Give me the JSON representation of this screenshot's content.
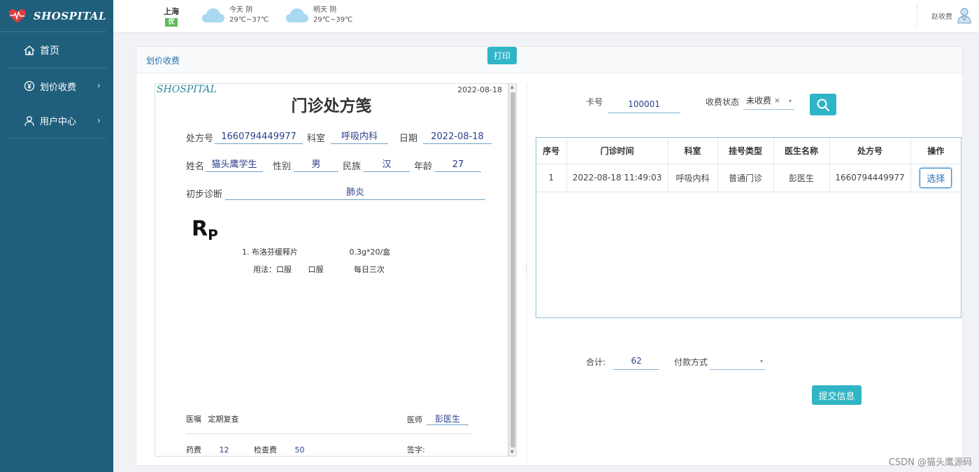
{
  "brand": {
    "name": "SHOSPITAL"
  },
  "sidebar": {
    "items": [
      {
        "label": "首页",
        "icon": "home-icon"
      },
      {
        "label": "划价收费",
        "icon": "yen-circle-icon"
      },
      {
        "label": "用户中心",
        "icon": "user-icon"
      }
    ]
  },
  "header": {
    "city": "上海",
    "aqi": "优",
    "today": {
      "label": "今天  阴",
      "temp": "29℃~37℃"
    },
    "tomorrow": {
      "label": "明天  阴",
      "temp": "29℃~39℃"
    },
    "user": "赵收费"
  },
  "panel": {
    "title": "划价收费",
    "print_label": "打印"
  },
  "prescription": {
    "brand": "SHOSPITAL",
    "date_top": "2022-08-18",
    "title": "门诊处方笺",
    "labels": {
      "rx_no": "处方号",
      "dept": "科室",
      "date": "日期",
      "name": "姓名",
      "gender": "性别",
      "ethnicity": "民族",
      "age": "年龄",
      "diagnosis": "初步诊断",
      "advice": "医嘱",
      "doctor": "医师",
      "drug_fee": "药费",
      "exam_fee": "检查费",
      "signature": "签字:"
    },
    "values": {
      "rx_no": "1660794449977",
      "dept": "呼吸内科",
      "date": "2022-08-18",
      "name": "猫头鹰学生",
      "gender": "男",
      "ethnicity": "汉",
      "age": "27",
      "diagnosis": "肺炎",
      "advice": "定期复查",
      "doctor": "彭医生",
      "drug_fee": "12",
      "exam_fee": "50"
    },
    "rp_main": "R",
    "rp_sub": "P",
    "medicine": {
      "name": "1. 布洛芬缓释片",
      "spec": "0.3g*20/盒"
    },
    "usage": {
      "label": "用法：口服",
      "route": "口服",
      "frequency": "每日三次"
    }
  },
  "search": {
    "card_label": "卡号",
    "card_value": "100001",
    "status_label": "收费状态",
    "status_value": "未收费",
    "clear_glyph": "×",
    "caret_glyph": "▾"
  },
  "table": {
    "headers": [
      "序号",
      "门诊时间",
      "科室",
      "挂号类型",
      "医生名称",
      "处方号",
      "操作"
    ],
    "rows": [
      {
        "no": "1",
        "time": "2022-08-18 11:49:03",
        "dept": "呼吸内科",
        "reg_type": "普通门诊",
        "doctor": "彭医生",
        "rx_no": "1660794449977",
        "action": "选择"
      }
    ]
  },
  "summary": {
    "total_label": "合计:",
    "total_value": "62",
    "pay_label": "付款方式",
    "pay_value": "",
    "submit_label": "提交信息"
  },
  "watermark": "CSDN @猫头鹰源码",
  "colors": {
    "sidebar": "#1f5f7c",
    "accent": "#2fb5c5",
    "link": "#2a6fb0"
  }
}
